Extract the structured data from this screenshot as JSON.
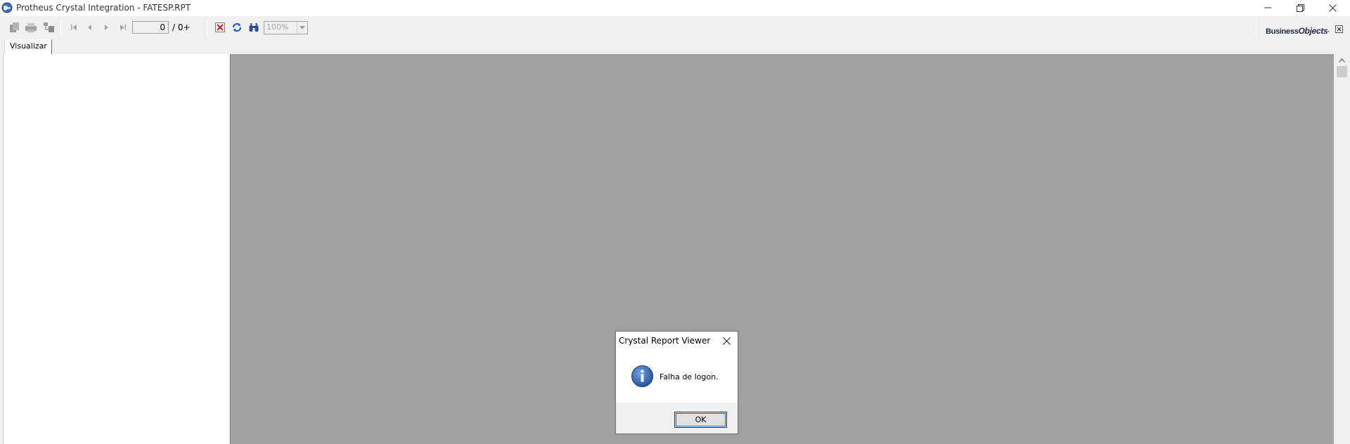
{
  "window": {
    "title": "Protheus Crystal Integration - FATESP.RPT",
    "icons": [
      "app-globe-icon",
      "minimize-icon",
      "restore-icon",
      "close-icon"
    ]
  },
  "toolbar": {
    "icons": [
      "export-icon",
      "print-icon",
      "toggle-group-tree-icon",
      "first-page-icon",
      "previous-page-icon",
      "next-page-icon",
      "last-page-icon",
      "stop-icon",
      "refresh-icon",
      "search-binoculars-icon"
    ],
    "page_current": "0",
    "page_total": "/ 0+",
    "zoom_value": "100%",
    "brand": {
      "name_part1": "Business",
      "name_part2": "Objects",
      "mark": "·"
    }
  },
  "tabs": [
    {
      "label": "Visualizar",
      "active": true
    }
  ],
  "dialog": {
    "title": "Crystal Report Viewer",
    "message": "Falha de logon.",
    "ok_label": "OK",
    "icon": "info-icon"
  },
  "colors": {
    "report_background": "#a0a0a0",
    "toolbar_background": "#f0f0f0",
    "accent_focus": "#0078d7",
    "info_blue": "#1f4e9a"
  }
}
